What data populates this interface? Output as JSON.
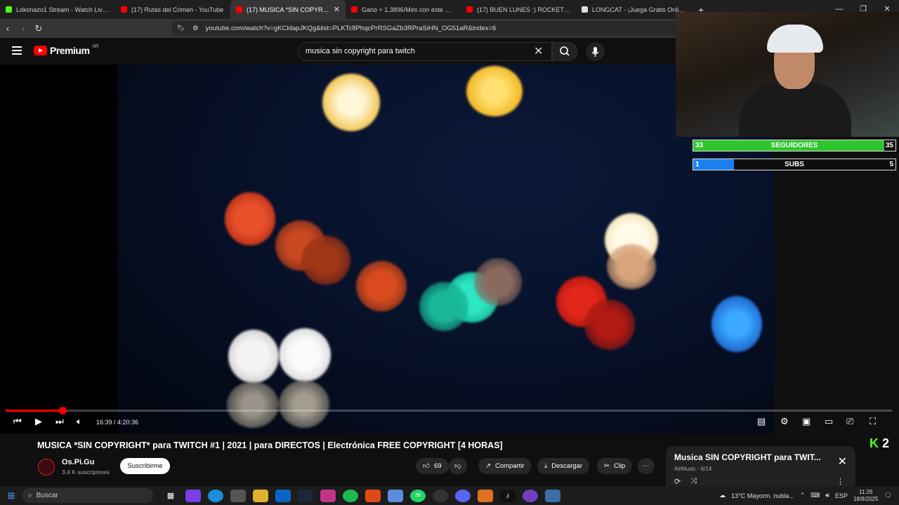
{
  "tabs": [
    {
      "title": "Lokonazo1 Stream - Watch Live on K",
      "favicon_color": "#53fc18",
      "active": false
    },
    {
      "title": "(17) Rutas del Crimen - YouTube",
      "favicon_color": "#ff0000",
      "active": false
    },
    {
      "title": "(17) MUSICA *SIN COPYRIGHT*",
      "favicon_color": "#ff0000",
      "active": true
    },
    {
      "title": "Gano + 1.3896/Mes con este Canal de",
      "favicon_color": "#ff0000",
      "active": false
    },
    {
      "title": "(17) BUEN LUNES :) ROCKET CON SE",
      "favicon_color": "#ff0000",
      "active": false
    },
    {
      "title": "LONGCAT - ¡Juega Gratis Online! | Po",
      "favicon_color": "#dddddd",
      "active": false
    }
  ],
  "address_bar": {
    "url": "youtube.com/watch?v=gKCldapJKQg&list=PLKTc8PhqcPrRSGaZb3RPraSiHN_OG51aR&index=6"
  },
  "youtube": {
    "logo_text": "Premium",
    "country": "AR",
    "search_value": "musica sin copyright para twitch"
  },
  "player": {
    "current_time": "16:39",
    "duration": "4:20:36",
    "time_display": "16:39 / 4:20:36",
    "progress": 0.064
  },
  "overlay": {
    "followers": {
      "current": "33",
      "label": "SEGUIDORES",
      "goal": "35",
      "fill": 0.943
    },
    "subs": {
      "current": "1",
      "label": "SUBS",
      "goal": "5",
      "fill": 0.2
    }
  },
  "video": {
    "title": "MUSICA *SIN COPYRIGHT* para TWITCH #1 | 2021 | para DIRECTOS | Electrónica FREE COPYRIGHT [4 HORAS]",
    "channel": "Os.Pi.Gu",
    "subscribers": "3,4 K suscriptores",
    "subscribe_label": "Suscribirme",
    "likes": "69",
    "share_label": "Compartir",
    "download_label": "Descargar",
    "clip_label": "Clip"
  },
  "kick_badge": {
    "letter": "K",
    "count": "2"
  },
  "miniplayer": {
    "title": "Musica SIN COPYRIGHT para TWIT...",
    "subtitle": "AirMusic - 6/14"
  },
  "taskbar": {
    "search_placeholder": "Buscar",
    "whatsapp_badge": "39",
    "weather": "13°C  Mayorm. nubla...",
    "language": "ESP",
    "time": "11:26",
    "date": "18/8/2025"
  }
}
